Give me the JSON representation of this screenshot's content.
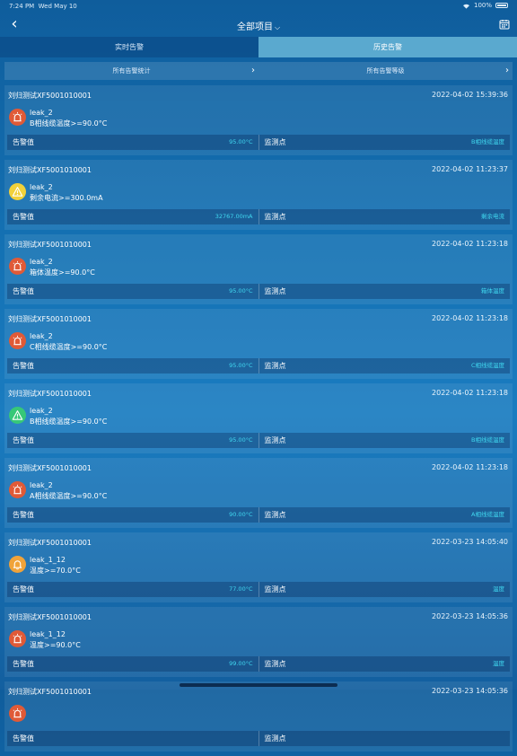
{
  "status": {
    "time": "7:24 PM",
    "date": "Wed May 10",
    "battery": "100%"
  },
  "nav": {
    "title": "全部项目"
  },
  "tabs": [
    {
      "label": "实时告警",
      "active": false
    },
    {
      "label": "历史告警",
      "active": true
    }
  ],
  "filters": [
    {
      "label": "所有告警统计"
    },
    {
      "label": "所有告警等级"
    }
  ],
  "labels": {
    "alarm_value": "告警值",
    "monitor_point": "监测点"
  },
  "colors": {
    "red": "#e05a37",
    "yellow": "#f2d13a",
    "green": "#37c878",
    "orange": "#f0a33a"
  },
  "alerts": [
    {
      "device": "刘归测试XF5001010001",
      "time": "2022-04-02 15:39:36",
      "code": "leak_2",
      "condition": "B相线缆温度>=90.0°C",
      "value": "95.00°C",
      "point": "B相线缆温度",
      "icon": "siren",
      "color": "red"
    },
    {
      "device": "刘归测试XF5001010001",
      "time": "2022-04-02 11:23:37",
      "code": "leak_2",
      "condition": "剩余电流>=300.0mA",
      "value": "32767.00mA",
      "point": "剩余电流",
      "icon": "warning",
      "color": "yellow"
    },
    {
      "device": "刘归测试XF5001010001",
      "time": "2022-04-02 11:23:18",
      "code": "leak_2",
      "condition": "箱体温度>=90.0°C",
      "value": "95.00°C",
      "point": "箱体温度",
      "icon": "siren",
      "color": "red"
    },
    {
      "device": "刘归测试XF5001010001",
      "time": "2022-04-02 11:23:18",
      "code": "leak_2",
      "condition": "C相线缆温度>=90.0°C",
      "value": "95.00°C",
      "point": "C相线缆温度",
      "icon": "siren",
      "color": "red"
    },
    {
      "device": "刘归测试XF5001010001",
      "time": "2022-04-02 11:23:18",
      "code": "leak_2",
      "condition": "B相线缆温度>=90.0°C",
      "value": "95.00°C",
      "point": "B相线缆温度",
      "icon": "warning",
      "color": "green"
    },
    {
      "device": "刘归测试XF5001010001",
      "time": "2022-04-02 11:23:18",
      "code": "leak_2",
      "condition": "A相线缆温度>=90.0°C",
      "value": "90.00°C",
      "point": "A相线缆温度",
      "icon": "siren",
      "color": "red"
    },
    {
      "device": "刘归测试XF5001010001",
      "time": "2022-03-23 14:05:40",
      "code": "leak_1_12",
      "condition": "温度>=70.0°C",
      "value": "77.00°C",
      "point": "温度",
      "icon": "bell",
      "color": "orange"
    },
    {
      "device": "刘归测试XF5001010001",
      "time": "2022-03-23 14:05:36",
      "code": "leak_1_12",
      "condition": "温度>=90.0°C",
      "value": "99.00°C",
      "point": "温度",
      "icon": "siren",
      "color": "red"
    },
    {
      "device": "刘归测试XF5001010001",
      "time": "2022-03-23 14:05:36",
      "code": "",
      "condition": "",
      "value": "",
      "point": "",
      "icon": "siren",
      "color": "red"
    }
  ]
}
